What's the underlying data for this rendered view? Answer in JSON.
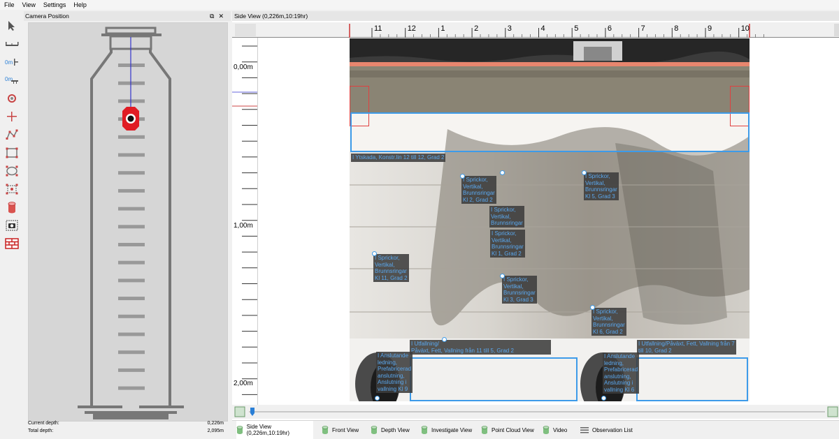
{
  "menu": {
    "items": [
      "File",
      "View",
      "Settings",
      "Help"
    ]
  },
  "camera_panel": {
    "title": "Camera Position",
    "current_depth_label": "Current depth:",
    "current_depth_value": "0,226m",
    "total_depth_label": "Total depth:",
    "total_depth_value": "2,095m"
  },
  "side_view": {
    "title": "Side View (0,226m,10:19hr)",
    "hour_ticks": [
      "11",
      "12",
      "1",
      "2",
      "3",
      "4",
      "5",
      "6",
      "7",
      "8",
      "9",
      "10"
    ],
    "depth_labels": [
      "0,00m",
      "1,00m",
      "2,00m"
    ],
    "observations": {
      "o1": "I Ytskada, Konstr.lin 12 till 12, Grad 2",
      "o2": "I Sprickor,\nVertikal,\nBrunnsringar\nKl 2, Grad 2",
      "o3": "I Sprickor,\nVertikal,\nBrunnsringar\nKl 5, Grad 3",
      "o4": "I Sprickor,\nVertikal,\nBrunnsringar",
      "o5": "I Sprickor,\nVertikal,\nBrunnsringar\nKl 1, Grad 2",
      "o6": "I Sprickor,\nVertikal,\nBrunnsringar\nKl 11, Grad 2",
      "o7": "I Sprickor,\nVertikal,\nBrunnsringar\nKl 3, Grad 3",
      "o8": "I Sprickor,\nVertikal,\nBrunnsringar\nKl 6, Grad 2",
      "o9": "I Utfallning/\nPåväxt, Fett, Vallning från 11 till 5, Grad 2",
      "o10": "I Anslutande\nledning,\nPrefabricerad\nanslutning,\nAnslutning i\nvallning Kl 9",
      "o11": "I Utfallning/Påväxt, Fett, Vallning från 7\ntill 10, Grad 2",
      "o12": "I Anslutande\nledning,\nPrefabricerad\nanslutning,\nAnslutning i\nvallning Kl 6"
    }
  },
  "tabs": [
    {
      "label": "Side View (0,226m,10:19hr)",
      "icon": "cylinder-icon"
    },
    {
      "label": "Front View",
      "icon": "cylinder-icon"
    },
    {
      "label": "Depth View",
      "icon": "cylinder-icon"
    },
    {
      "label": "Investigate View",
      "icon": "cylinder-icon"
    },
    {
      "label": "Point Cloud View",
      "icon": "cylinder-icon"
    },
    {
      "label": "Video",
      "icon": "cylinder-icon"
    },
    {
      "label": "Observation List",
      "icon": "list-icon"
    }
  ],
  "colors": {
    "accent_blue": "#3d9be9",
    "marker_red": "#e01c24",
    "highlight_red": "#e04040"
  }
}
